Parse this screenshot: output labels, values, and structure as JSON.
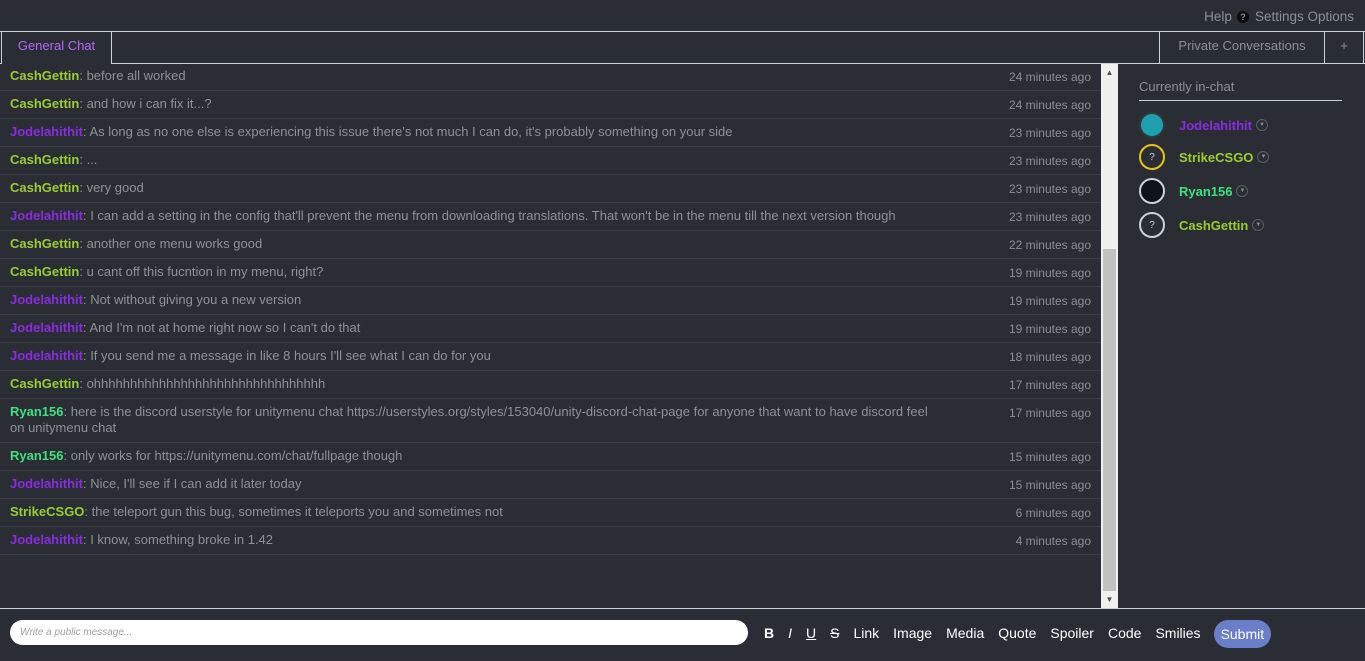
{
  "topbar": {
    "help": "Help",
    "help_icon": "?",
    "settings": "Settings Options"
  },
  "tabs": {
    "general": "General Chat",
    "private": "Private Conversations",
    "plus": "+"
  },
  "messages": [
    {
      "user": "CashGettin",
      "cls": "u-cash",
      "text": "before all worked",
      "time": "24 minutes ago"
    },
    {
      "user": "CashGettin",
      "cls": "u-cash",
      "text": "and how i can fix it...?",
      "time": "24 minutes ago"
    },
    {
      "user": "Jodelahithit",
      "cls": "u-jodel",
      "text": "As long as no one else is experiencing this issue there's not much I can do, it's probably something on your side",
      "time": "23 minutes ago"
    },
    {
      "user": "CashGettin",
      "cls": "u-cash",
      "text": "...",
      "time": "23 minutes ago"
    },
    {
      "user": "CashGettin",
      "cls": "u-cash",
      "text": "very good",
      "time": "23 minutes ago"
    },
    {
      "user": "Jodelahithit",
      "cls": "u-jodel",
      "text": "I can add a setting in the config that'll prevent the menu from downloading translations. That won't be in the menu till the next version though",
      "time": "23 minutes ago"
    },
    {
      "user": "CashGettin",
      "cls": "u-cash",
      "text": "another one menu works good",
      "time": "22 minutes ago"
    },
    {
      "user": "CashGettin",
      "cls": "u-cash",
      "text": "u cant off this fucntion in my menu, right?",
      "time": "19 minutes ago"
    },
    {
      "user": "Jodelahithit",
      "cls": "u-jodel",
      "text": "Not without giving you a new version",
      "time": "19 minutes ago"
    },
    {
      "user": "Jodelahithit",
      "cls": "u-jodel",
      "text": "And I'm not at home right now so I can't do that",
      "time": "19 minutes ago"
    },
    {
      "user": "Jodelahithit",
      "cls": "u-jodel",
      "text": "If you send me a message in like 8 hours I'll see what I can do for you",
      "time": "18 minutes ago"
    },
    {
      "user": "CashGettin",
      "cls": "u-cash",
      "text": "ohhhhhhhhhhhhhhhhhhhhhhhhhhhhhhhh",
      "time": "17 minutes ago"
    },
    {
      "user": "Ryan156",
      "cls": "u-ryan",
      "text": "here is the discord userstyle for unitymenu chat https://userstyles.org/styles/153040/unity-discord-chat-page for anyone that want to have discord feel on unitymenu chat",
      "time": "17 minutes ago"
    },
    {
      "user": "Ryan156",
      "cls": "u-ryan",
      "text": "only works for https://unitymenu.com/chat/fullpage though",
      "time": "15 minutes ago"
    },
    {
      "user": "Jodelahithit",
      "cls": "u-jodel",
      "text": "Nice, I'll see if I can add it later today",
      "time": "15 minutes ago"
    },
    {
      "user": "StrikeCSGO",
      "cls": "u-strike",
      "text": "the teleport gun this bug, sometimes it teleports you and sometimes not",
      "time": "6 minutes ago"
    },
    {
      "user": "Jodelahithit",
      "cls": "u-jodel",
      "text": "I know, something broke in 1.42",
      "time": "4 minutes ago"
    }
  ],
  "sidebar": {
    "title": "Currently in-chat",
    "users": [
      {
        "name": "Jodelahithit",
        "color": "#8a2be2",
        "avatar_icon": "blue-swirl-avatar",
        "avatar_bg": "#1e9fb0",
        "avatar_border": "#2f3a3a",
        "avatar_glyph": ""
      },
      {
        "name": "StrikeCSGO",
        "color": "#9acd32",
        "avatar_icon": "question-mark-avatar",
        "avatar_bg": "#2a2d33",
        "avatar_border": "#e6c21a",
        "avatar_glyph": "?"
      },
      {
        "name": "Ryan156",
        "color": "#3ee080",
        "avatar_icon": "dark-logo-avatar",
        "avatar_bg": "#0e1418",
        "avatar_border": "#c9d3dc",
        "avatar_glyph": ""
      },
      {
        "name": "CashGettin",
        "color": "#9acd32",
        "avatar_icon": "question-mark-avatar",
        "avatar_bg": "#2a2d33",
        "avatar_border": "#c9d3dc",
        "avatar_glyph": "?"
      }
    ]
  },
  "composer": {
    "placeholder": "Write a public message...",
    "tools": [
      "B",
      "I",
      "U",
      "S",
      "Link",
      "Image",
      "Media",
      "Quote",
      "Spoiler",
      "Code",
      "Smilies"
    ],
    "submit": "Submit"
  }
}
